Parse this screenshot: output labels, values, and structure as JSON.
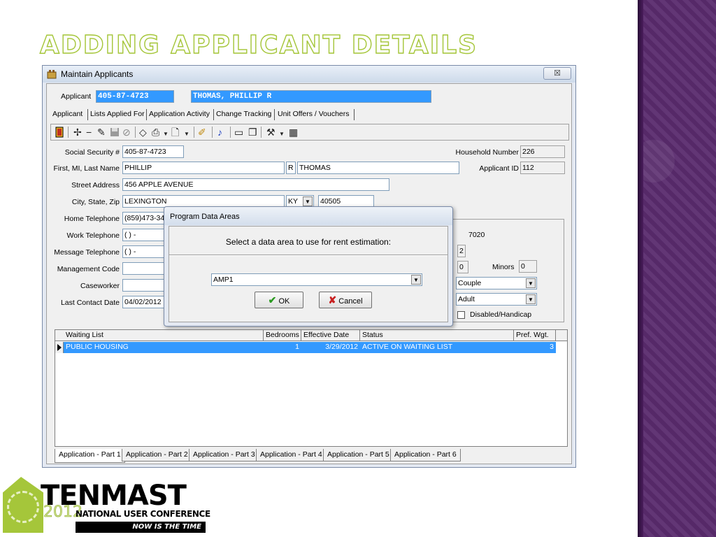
{
  "slide": {
    "title": "ADDING APPLICANT DETAILS"
  },
  "window": {
    "title": "Maintain Applicants",
    "close_glyph": "☒"
  },
  "applicant_bar": {
    "label": "Applicant",
    "id": "405-87-4723",
    "name": "THOMAS, PHILLIP R"
  },
  "tabs": [
    "Applicant",
    "Lists Applied For",
    "Application Activity",
    "Change Tracking",
    "Unit Offers / Vouchers"
  ],
  "form": {
    "ssn_label": "Social Security #",
    "ssn": "405-87-4723",
    "name_label": "First, MI, Last Name",
    "first": "PHILLIP",
    "mi": "R",
    "last": "THOMAS",
    "street_label": "Street Address",
    "street": "456 APPLE AVENUE",
    "csz_label": "City, State, Zip",
    "city": "LEXINGTON",
    "state": "KY",
    "zip": "40505",
    "home_tel_label": "Home Telephone",
    "home_tel": "(859)473-347",
    "work_tel_label": "Work Telephone",
    "work_tel": "(  )  -",
    "msg_tel_label": "Message Telephone",
    "msg_tel": "(  )  -",
    "mgmt_label": "Management Code",
    "caseworker_label": "Caseworker",
    "last_contact_label": "Last Contact Date",
    "last_contact": "04/02/2012",
    "household_number_label": "Household Number",
    "household_number": "226",
    "applicant_id_label": "Applicant ID",
    "applicant_id": "112",
    "income": "7020",
    "members": "2",
    "adults": "0",
    "minors_label": "Minors",
    "minors": "0",
    "household_type": "Couple",
    "head_type": "Adult",
    "disabled_label": "Disabled/Handicap"
  },
  "grid": {
    "headers": [
      "Waiting List",
      "Bedrooms",
      "Effective Date",
      "Status",
      "Pref. Wgt."
    ],
    "rows": [
      {
        "list": "PUBLIC HOUSING",
        "bedrooms": "1",
        "date": "3/29/2012",
        "status": "ACTIVE ON WAITING LIST",
        "pref": "3"
      }
    ]
  },
  "bottom_tabs": [
    "Application - Part 1",
    "Application - Part 2",
    "Application - Part 3",
    "Application - Part 4",
    "Application - Part 5",
    "Application - Part 6"
  ],
  "dialog": {
    "title": "Program Data Areas",
    "message": "Select a data area to use for rent estimation:",
    "selected": "AMP1",
    "ok_label": "OK",
    "cancel_label": "Cancel"
  },
  "logo": {
    "brand": "TENMAST",
    "year": "2012",
    "conference": "NATIONAL USER CONFERENCE",
    "tagline": "NOW IS THE TIME"
  },
  "colors": {
    "title_green": "#a5c63a",
    "band_purple": "#5a2b6e",
    "selection_blue": "#3399ff"
  }
}
